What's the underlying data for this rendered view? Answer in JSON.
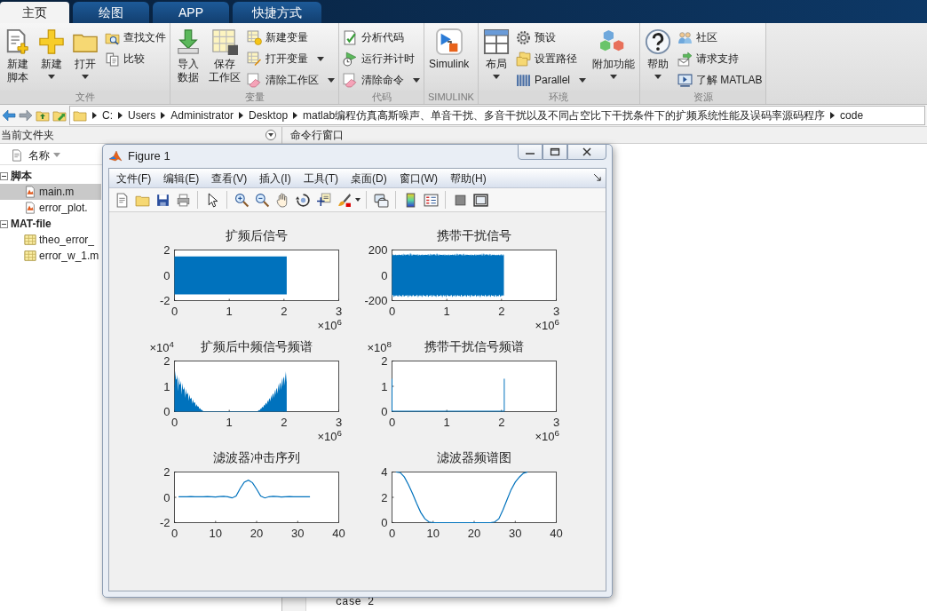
{
  "tabs": [
    {
      "label": "主页",
      "selected": true
    },
    {
      "label": "绘图",
      "selected": false
    },
    {
      "label": "APP",
      "selected": false
    },
    {
      "label": "快捷方式",
      "selected": false
    }
  ],
  "ribbon": {
    "sections": [
      {
        "label": "文件",
        "groups": [
          {
            "kind": "large",
            "lines": [
              "新建",
              "脚本"
            ],
            "dropdown": false
          },
          {
            "kind": "large",
            "lines": [
              "新建"
            ],
            "dropdown": true
          },
          {
            "kind": "large",
            "lines": [
              "打开"
            ],
            "dropdown": true
          },
          {
            "kind": "stack",
            "items": [
              {
                "label": "查找文件",
                "dropdown": false
              },
              {
                "label": "比较",
                "dropdown": false
              }
            ]
          }
        ]
      },
      {
        "label": "变量",
        "groups": [
          {
            "kind": "large",
            "lines": [
              "导入",
              "数据"
            ],
            "dropdown": false
          },
          {
            "kind": "large",
            "lines": [
              "保存",
              "工作区"
            ],
            "dropdown": false
          },
          {
            "kind": "stack",
            "items": [
              {
                "label": "新建变量",
                "dropdown": false
              },
              {
                "label": "打开变量",
                "dropdown": true
              },
              {
                "label": "清除工作区",
                "dropdown": true
              }
            ]
          }
        ]
      },
      {
        "label": "代码",
        "groups": [
          {
            "kind": "stack",
            "items": [
              {
                "label": "分析代码",
                "dropdown": false
              },
              {
                "label": "运行并计时",
                "dropdown": false
              },
              {
                "label": "清除命令",
                "dropdown": true
              }
            ]
          }
        ]
      },
      {
        "label": "SIMULINK",
        "groups": [
          {
            "kind": "large",
            "lines": [
              "Simulink"
            ],
            "dropdown": false
          }
        ]
      },
      {
        "label": "环境",
        "groups": [
          {
            "kind": "large",
            "lines": [
              "布局"
            ],
            "dropdown": true
          },
          {
            "kind": "stack",
            "items": [
              {
                "label": "预设",
                "dropdown": false
              },
              {
                "label": "设置路径",
                "dropdown": false
              },
              {
                "label": "Parallel",
                "dropdown": true
              }
            ]
          },
          {
            "kind": "large",
            "lines": [
              "附加功能"
            ],
            "dropdown": true
          }
        ]
      },
      {
        "label": "资源",
        "groups": [
          {
            "kind": "large",
            "lines": [
              "帮助"
            ],
            "dropdown": true
          },
          {
            "kind": "stack",
            "items": [
              {
                "label": "社区",
                "dropdown": false
              },
              {
                "label": "请求支持",
                "dropdown": false
              },
              {
                "label": "了解 MATLAB",
                "dropdown": false
              }
            ]
          }
        ]
      }
    ]
  },
  "address_bar": {
    "path": [
      "C:",
      "Users",
      "Administrator",
      "Desktop",
      "matlab编程仿真高斯噪声、单音干扰、多音干扰以及不同占空比下干扰条件下的扩频系统性能及误码率源码程序",
      "code"
    ]
  },
  "current_folder": {
    "title": "当前文件夹",
    "column": "名称",
    "groups": [
      {
        "label": "脚本",
        "expanded": true,
        "files": [
          {
            "name": "main.m",
            "kind": "m",
            "selected": true
          },
          {
            "name": "error_plot.",
            "kind": "m",
            "selected": false
          }
        ]
      },
      {
        "label": "MAT-file",
        "expanded": true,
        "files": [
          {
            "name": "theo_error_",
            "kind": "mat",
            "selected": false
          },
          {
            "name": "error_w_1.m",
            "kind": "mat",
            "selected": false
          }
        ]
      }
    ]
  },
  "command_window": {
    "title": "命令行窗口",
    "lines": [
      "case 2"
    ]
  },
  "figure": {
    "title": "Figure 1",
    "menu": [
      "文件(F)",
      "编辑(E)",
      "查看(V)",
      "插入(I)",
      "工具(T)",
      "桌面(D)",
      "窗口(W)",
      "帮助(H)"
    ],
    "plots": [
      {
        "kind": "block",
        "title": "扩频后信号",
        "xticks": [
          "0",
          "1",
          "2",
          "3"
        ],
        "yticks": [
          "2",
          "0",
          "-2"
        ],
        "x_exponent": "×10$^{6}$"
      },
      {
        "kind": "noise",
        "title": "携带干扰信号",
        "xticks": [
          "0",
          "1",
          "2",
          "3"
        ],
        "yticks": [
          "200",
          "0",
          "-200"
        ],
        "x_exponent": "×10$^{6}$"
      },
      {
        "kind": "spectrum",
        "title": "扩频后中频信号频谱",
        "xticks": [
          "0",
          "1",
          "2",
          "3"
        ],
        "yticks": [
          "2",
          "1",
          "0"
        ],
        "y_exponent": "×10$^{4}$",
        "x_exponent": "×10$^{6}$"
      },
      {
        "kind": "spikes",
        "title": "携带干扰信号频谱",
        "xticks": [
          "0",
          "1",
          "2",
          "3"
        ],
        "yticks": [
          "2",
          "1",
          "0"
        ],
        "y_exponent": "×10$^{8}$",
        "x_exponent": "×10$^{6}$"
      },
      {
        "kind": "line",
        "title": "滤波器冲击序列",
        "chart_data": {
          "type": "line",
          "x": [
            1,
            2,
            3,
            4,
            5,
            6,
            7,
            8,
            9,
            10,
            11,
            12,
            13,
            14,
            15,
            16,
            17,
            18,
            19,
            20,
            21,
            22,
            23,
            24,
            25,
            26,
            27,
            28,
            29,
            30,
            31,
            32,
            33
          ],
          "series": [
            {
              "color": "#0072bd",
              "values": [
                0.05,
                0.05,
                0.05,
                0.06,
                0.05,
                0.04,
                0.05,
                0.06,
                0.05,
                0.03,
                0.06,
                0.08,
                0.05,
                -0.05,
                0.1,
                0.7,
                1.2,
                1.35,
                1.15,
                0.65,
                0.1,
                -0.05,
                0.05,
                0.08,
                0.06,
                0.03,
                0.05,
                0.06,
                0.05,
                0.04,
                0.05,
                0.05,
                0.05
              ]
            }
          ],
          "xlim": [
            0,
            40
          ],
          "ylim": [
            -2,
            2
          ],
          "xticks": [
            0,
            10,
            20,
            30,
            40
          ],
          "yticks": [
            -2,
            0,
            2
          ]
        }
      },
      {
        "kind": "line",
        "title": "滤波器频谱图",
        "chart_data": {
          "type": "line",
          "x": [
            1,
            2,
            3,
            4,
            5,
            6,
            7,
            8,
            9,
            10,
            11,
            12,
            13,
            14,
            15,
            16,
            17,
            18,
            19,
            20,
            21,
            22,
            23,
            24,
            25,
            26,
            27,
            28,
            29,
            30,
            31,
            32,
            33
          ],
          "series": [
            {
              "color": "#0072bd",
              "values": [
                4,
                3.95,
                3.6,
                3.0,
                2.3,
                1.5,
                0.8,
                0.3,
                0.05,
                0,
                0,
                0,
                0,
                0,
                0,
                0,
                0,
                0,
                0,
                0,
                0,
                0,
                0,
                0,
                0.05,
                0.3,
                1.0,
                1.8,
                2.6,
                3.2,
                3.6,
                3.9,
                4
              ]
            }
          ],
          "xlim": [
            0,
            40
          ],
          "ylim": [
            0,
            4
          ],
          "xticks": [
            0,
            10,
            20,
            30,
            40
          ],
          "yticks": [
            0,
            2,
            4
          ]
        }
      }
    ]
  }
}
